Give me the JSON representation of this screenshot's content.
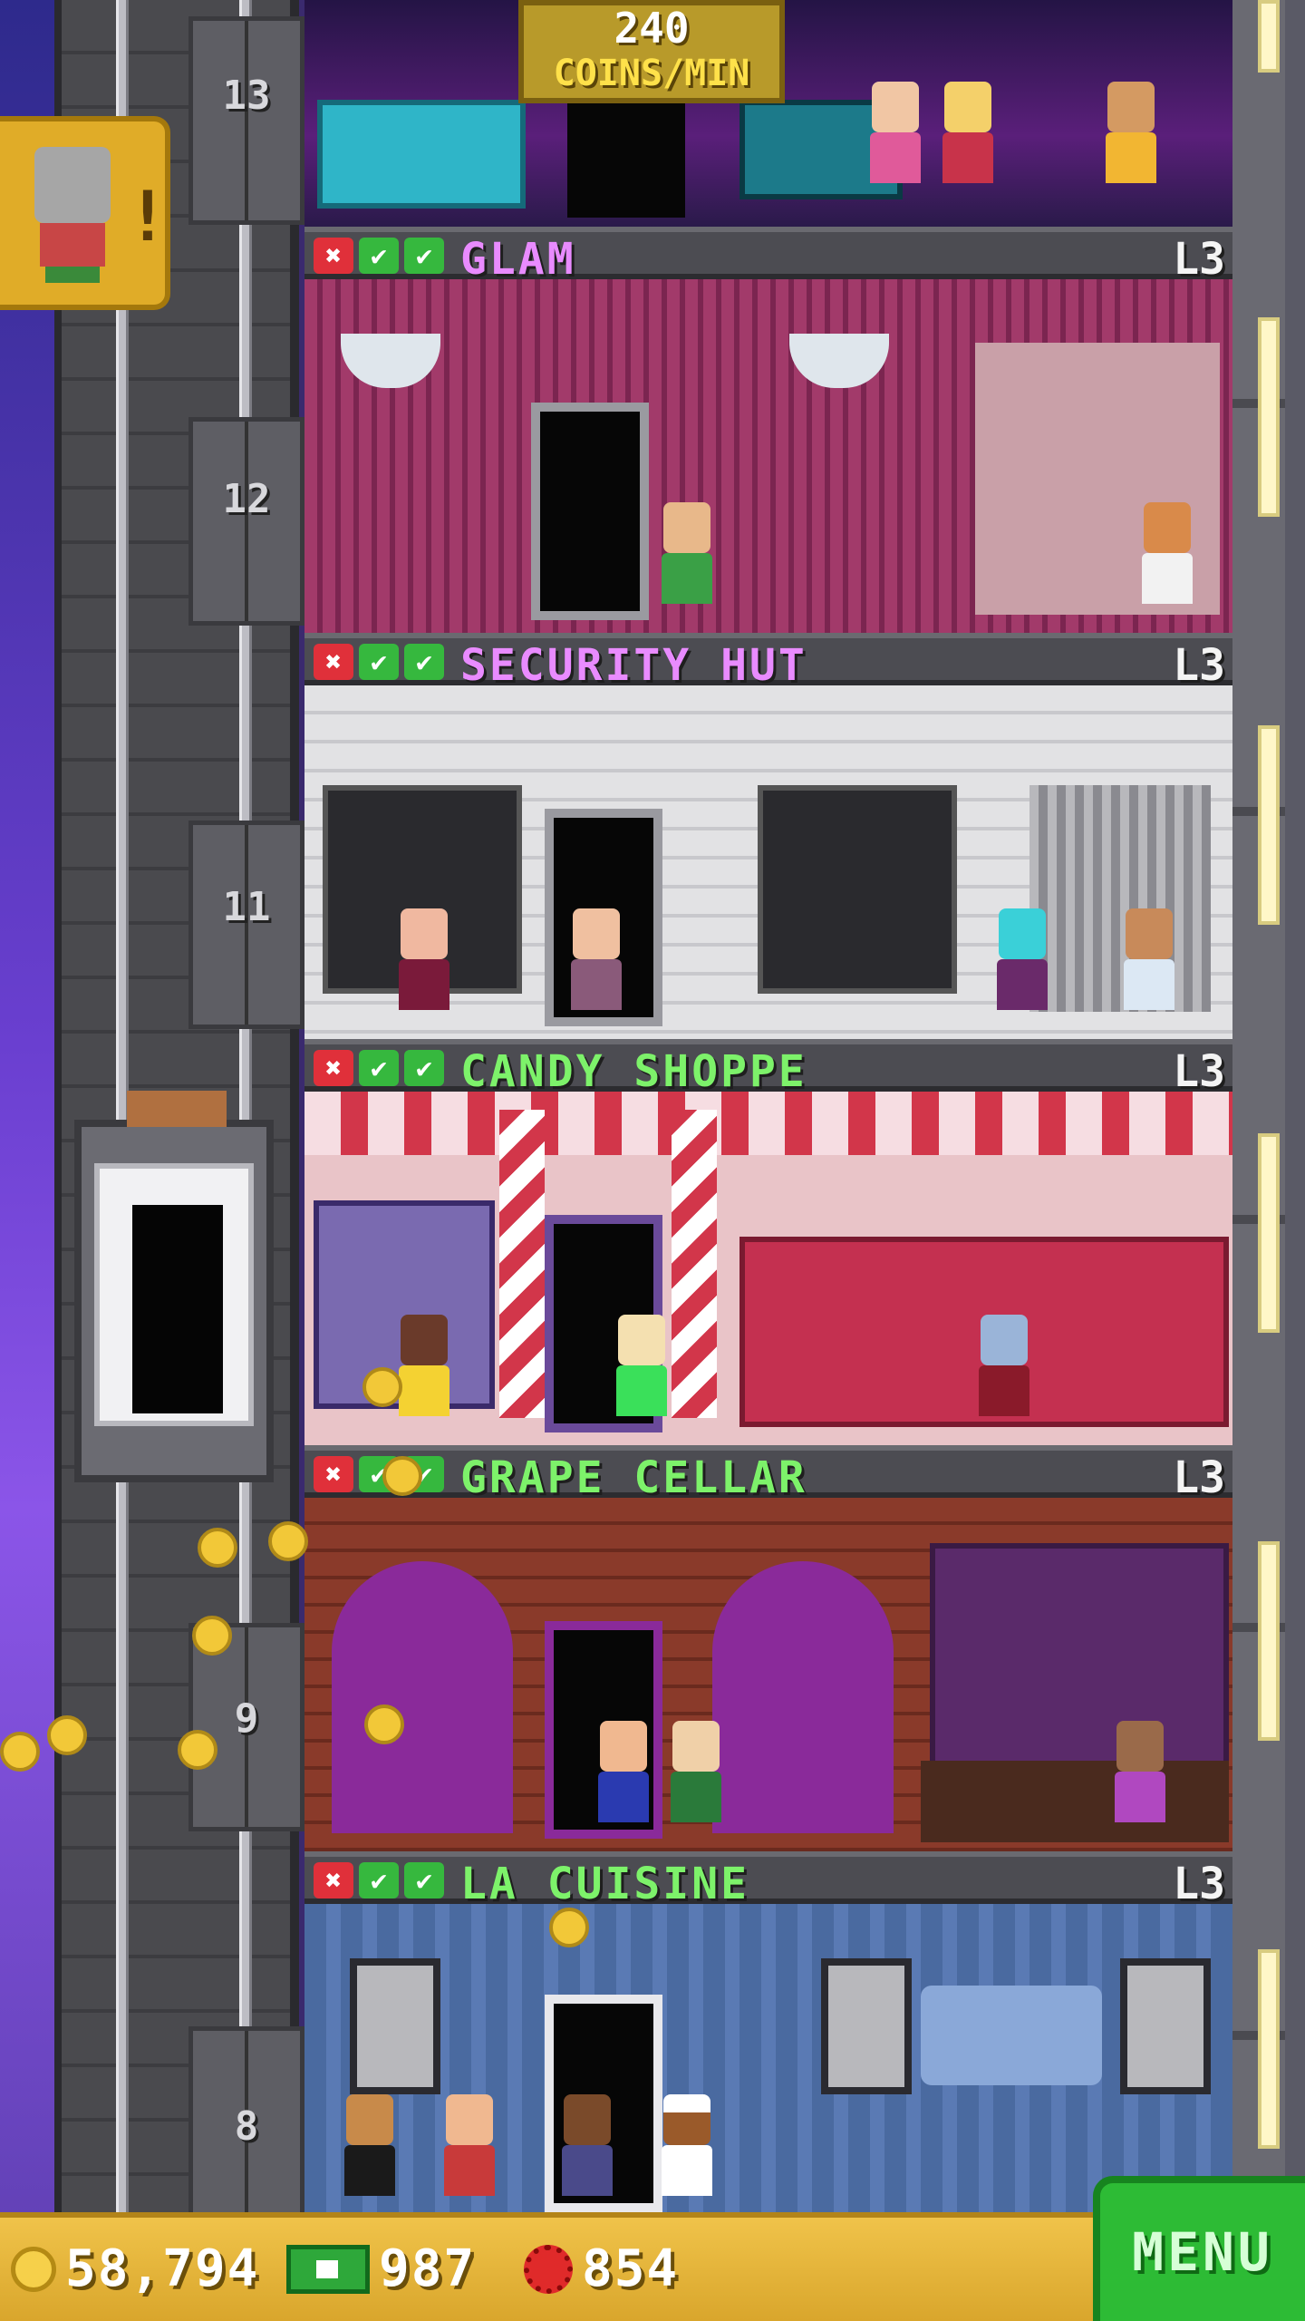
{
  "top_floor": {
    "coins_rate_amount": "240",
    "coins_rate_label": "COINS/MIN"
  },
  "shaft": {
    "floor_numbers": [
      "13",
      "12",
      "11",
      "9",
      "8"
    ]
  },
  "floors": [
    {
      "name": "GLAM",
      "level": "L3",
      "name_color": "#e98bff",
      "room_color": "#a23a6a",
      "room_accent": "#7b2550"
    },
    {
      "name": "SECURITY HUT",
      "level": "L3",
      "name_color": "#e98bff",
      "room_color": "#d6d6d8",
      "room_accent": "#9a9aa0"
    },
    {
      "name": "CANDY SHOPPE",
      "level": "L3",
      "name_color": "#7df26a",
      "room_color": "#f0d0d8",
      "room_accent": "#d2364a"
    },
    {
      "name": "GRAPE CELLAR",
      "level": "L3",
      "name_color": "#7df26a",
      "room_color": "#7a3a2a",
      "room_accent": "#8a2a9a"
    },
    {
      "name": "LA CUISINE",
      "level": "L3",
      "name_color": "#7df26a",
      "room_color": "#4a6aa0",
      "room_accent": "#6a8ac0"
    }
  ],
  "status_icons": {
    "x_icon": "✖",
    "check_icon": "✔"
  },
  "bottom_bar": {
    "coins": "58,794",
    "bux": "987",
    "chips": "854",
    "menu_label": "MENU"
  },
  "colors": {
    "menu_green": "#2dbb35",
    "bar_gold": "#e8b83a",
    "notification_gold": "#e0ac28"
  }
}
